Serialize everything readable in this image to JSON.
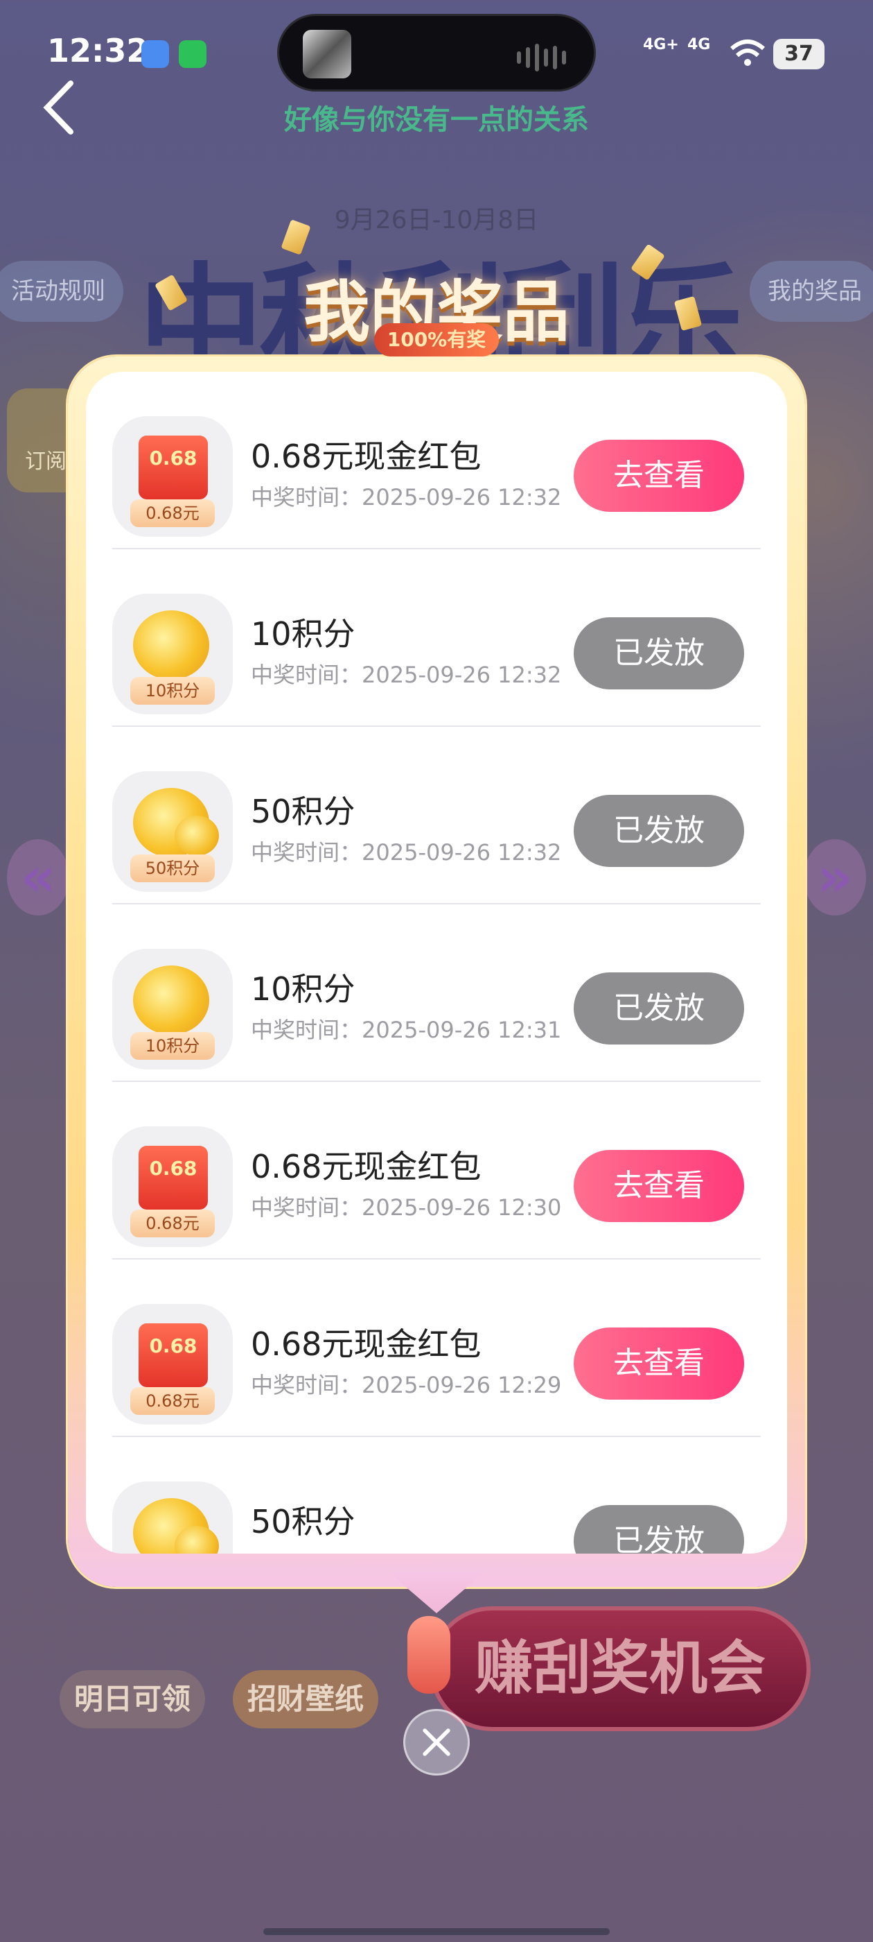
{
  "status_bar": {
    "time": "12:32",
    "network1": "4G+",
    "network2": "4G",
    "battery": "37"
  },
  "header": {
    "subtitle": "好像与你没有一点的关系"
  },
  "background": {
    "date_range": "9月26日-10月8日",
    "event_title": "中秋刮刮乐",
    "rules_button": "活动规则",
    "my_prizes_button": "我的奖品",
    "subscribe_label": "订阅",
    "tomorrow_button": "明日可领",
    "wallpaper_button": "招财壁纸",
    "earn_button": "赚刮奖机会"
  },
  "modal": {
    "title": "我的奖品",
    "badge": "100%有奖",
    "prizes": [
      {
        "name": "0.68元现金红包",
        "time": "中奖时间：2025-09-26 12:32",
        "icon": "red-envelope",
        "tag": "0.68元",
        "amount": "0.68",
        "action": "去查看",
        "status": "active"
      },
      {
        "name": "10积分",
        "time": "中奖时间：2025-09-26 12:32",
        "icon": "coin",
        "tag": "10积分",
        "action": "已发放",
        "status": "done"
      },
      {
        "name": "50积分",
        "time": "中奖时间：2025-09-26 12:32",
        "icon": "coins",
        "tag": "50积分",
        "action": "已发放",
        "status": "done"
      },
      {
        "name": "10积分",
        "time": "中奖时间：2025-09-26 12:31",
        "icon": "coin",
        "tag": "10积分",
        "action": "已发放",
        "status": "done"
      },
      {
        "name": "0.68元现金红包",
        "time": "中奖时间：2025-09-26 12:30",
        "icon": "red-envelope",
        "tag": "0.68元",
        "amount": "0.68",
        "action": "去查看",
        "status": "active"
      },
      {
        "name": "0.68元现金红包",
        "time": "中奖时间：2025-09-26 12:29",
        "icon": "red-envelope",
        "tag": "0.68元",
        "amount": "0.68",
        "action": "去查看",
        "status": "active"
      },
      {
        "name": "50积分",
        "time": "",
        "icon": "coins",
        "tag": "",
        "action": "已发放",
        "status": "done"
      }
    ]
  },
  "colors": {
    "accent_pink": "#ff3a7c",
    "disabled_gray": "#8e8e90",
    "subtitle_green": "#49b98c"
  }
}
